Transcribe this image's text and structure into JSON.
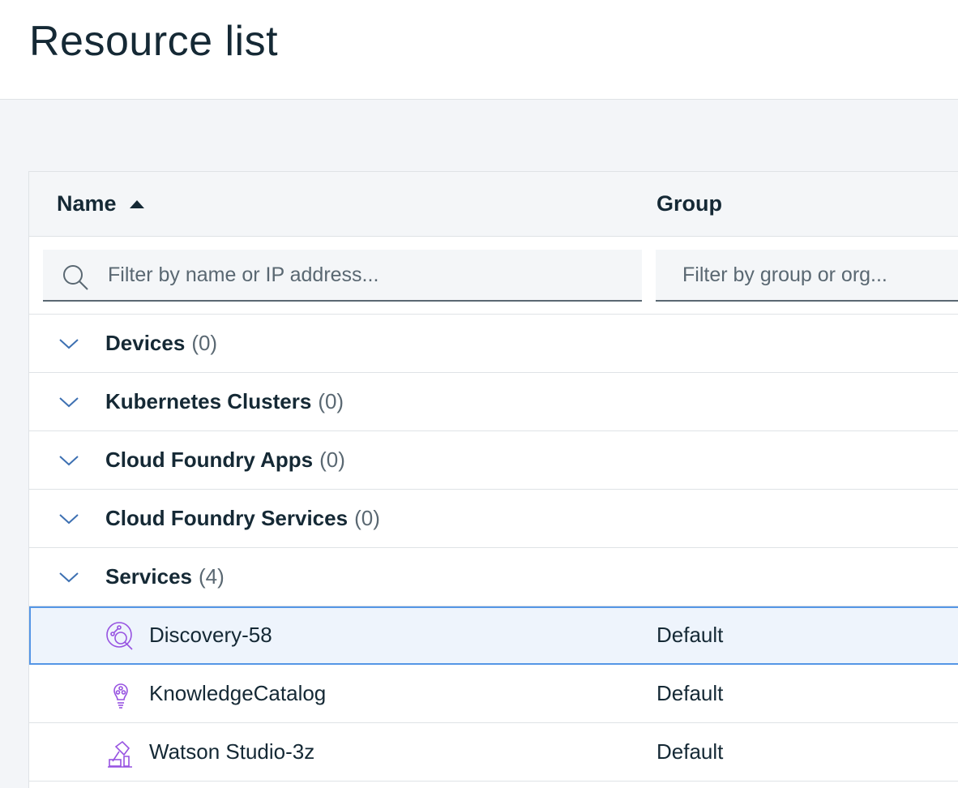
{
  "header": {
    "title": "Resource list"
  },
  "table": {
    "columns": {
      "name": "Name",
      "group": "Group"
    },
    "filters": {
      "name_placeholder": "Filter by name or IP address...",
      "group_placeholder": "Filter by group or org..."
    },
    "groups": [
      {
        "label": "Devices",
        "count": "(0)"
      },
      {
        "label": "Kubernetes Clusters",
        "count": "(0)"
      },
      {
        "label": "Cloud Foundry Apps",
        "count": "(0)"
      },
      {
        "label": "Cloud Foundry Services",
        "count": "(0)"
      },
      {
        "label": "Services",
        "count": "(4)"
      }
    ],
    "items": [
      {
        "name": "Discovery-58",
        "group": "Default",
        "icon": "discovery-icon"
      },
      {
        "name": "KnowledgeCatalog",
        "group": "Default",
        "icon": "lightbulb-icon"
      },
      {
        "name": "Watson Studio-3z",
        "group": "Default",
        "icon": "studio-icon"
      }
    ]
  },
  "colors": {
    "accent": "#5596e6",
    "service_icon": "#9753e1",
    "chevron": "#3d70b2"
  }
}
